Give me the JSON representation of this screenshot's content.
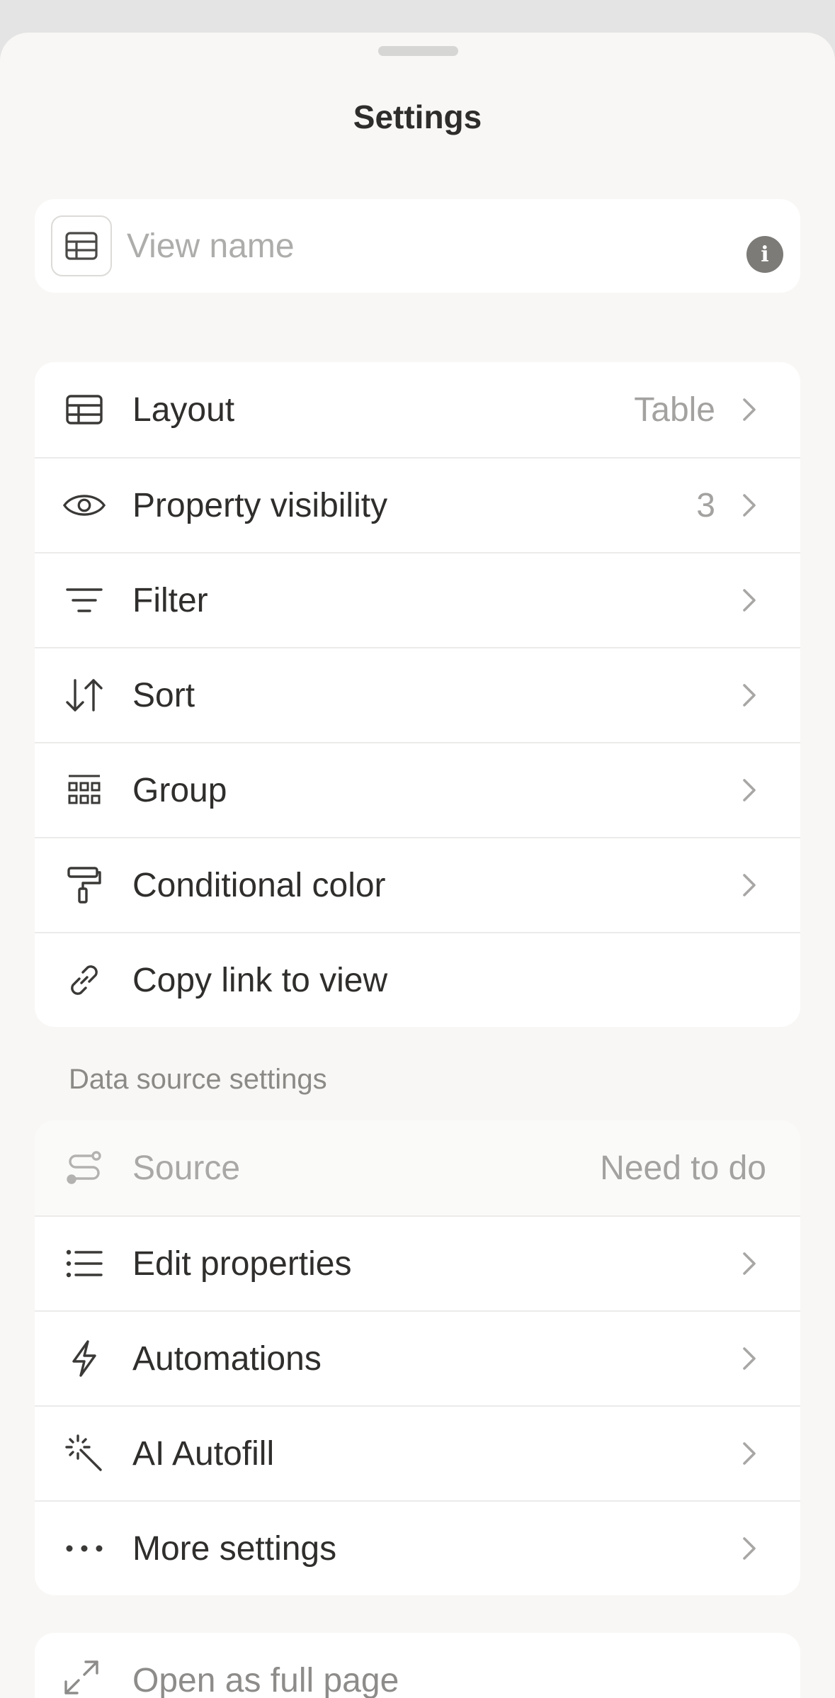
{
  "sheet": {
    "title": "Settings"
  },
  "view_name": {
    "placeholder": "View name",
    "value": "",
    "leading_icon": "table-icon",
    "info_icon": "info-icon"
  },
  "view_settings": [
    {
      "key": "layout",
      "label": "Layout",
      "value": "Table",
      "icon": "table-icon"
    },
    {
      "key": "property-visibility",
      "label": "Property visibility",
      "value": "3",
      "icon": "eye-icon"
    },
    {
      "key": "filter",
      "label": "Filter",
      "value": "",
      "icon": "filter-icon"
    },
    {
      "key": "sort",
      "label": "Sort",
      "value": "",
      "icon": "sort-arrows-icon"
    },
    {
      "key": "group",
      "label": "Group",
      "value": "",
      "icon": "group-grid-icon"
    },
    {
      "key": "conditional-color",
      "label": "Conditional color",
      "value": "",
      "icon": "paint-roller-icon"
    },
    {
      "key": "copy-link",
      "label": "Copy link to view",
      "value": "",
      "icon": "link-icon"
    }
  ],
  "data_source_section": {
    "label": "Data source settings",
    "items": [
      {
        "key": "source",
        "label": "Source",
        "value": "Need to do",
        "icon": "source-icon",
        "disabled": true
      },
      {
        "key": "edit-properties",
        "label": "Edit properties",
        "value": "",
        "icon": "list-icon"
      },
      {
        "key": "automations",
        "label": "Automations",
        "value": "",
        "icon": "lightning-icon"
      },
      {
        "key": "ai-autofill",
        "label": "AI Autofill",
        "value": "",
        "icon": "sparkle-wand-icon"
      },
      {
        "key": "more-settings",
        "label": "More settings",
        "value": "",
        "icon": "more-dots-icon"
      }
    ]
  },
  "open_full_page": {
    "label": "Open as full page",
    "icon": "expand-icon"
  }
}
